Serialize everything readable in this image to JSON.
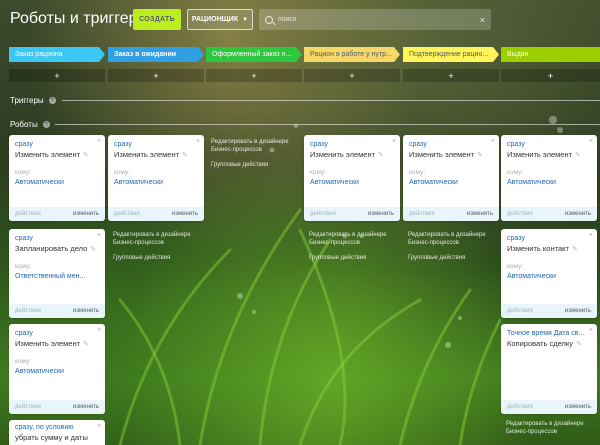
{
  "header": {
    "title": "Роботы и триггеры",
    "create_label": "СОЗДАТЬ",
    "filter_label": "РАЦИОНЩИК",
    "search_placeholder": "поиск"
  },
  "stages": [
    {
      "label": "Заказ рациона",
      "color": "#3bc8f5"
    },
    {
      "label": "Заказ в ожидании",
      "color": "#2fa0e4"
    },
    {
      "label": "Оформленный заказ н...",
      "color": "#2fc73d"
    },
    {
      "label": "Рацион в работе у нутр...",
      "color": "#f5d867"
    },
    {
      "label": "Подтверждение рацио...",
      "color": "#fff55a"
    },
    {
      "label": "Выдан",
      "color": "#9dcf00"
    }
  ],
  "add_label": "+",
  "sections": {
    "triggers": "Триггеры",
    "robots": "Роботы",
    "help": "?"
  },
  "card_common": {
    "to_label": "кому:",
    "actions_label": "действия",
    "change_label": "изменить",
    "close": "×",
    "pencil": "✎"
  },
  "links": {
    "designer": "Редактировать в дизайнере Бизнес-процессов",
    "group": "Групповые действия"
  },
  "robots": {
    "c1r1": {
      "when": "сразу",
      "name": "Изменить элемент",
      "resp": "Автоматически"
    },
    "c1r2": {
      "when": "сразу",
      "name": "Запланировать дело",
      "resp": "Ответственный мен..."
    },
    "c1r3": {
      "when": "сразу",
      "name": "Изменить элемент",
      "resp": "Автоматически"
    },
    "c1r4": {
      "when": "сразу, по условию",
      "name": "убрать сумму и даты если"
    },
    "c2r1": {
      "when": "сразу",
      "name": "Изменить элемент",
      "resp": "Автоматически"
    },
    "c4r1": {
      "when": "сразу",
      "name": "Изменить элемент",
      "resp": "Автоматически"
    },
    "c5r1": {
      "when": "сразу",
      "name": "Изменить элемент",
      "resp": "Автоматически"
    },
    "c6r1": {
      "when": "сразу",
      "name": "Изменить элемент",
      "resp": "Автоматически"
    },
    "c6r2": {
      "when": "сразу",
      "name": "Изменить контакт",
      "resp": "Автоматически"
    },
    "c6r3": {
      "when": "Точное время Дата св...",
      "name": "Копировать сделку"
    }
  }
}
